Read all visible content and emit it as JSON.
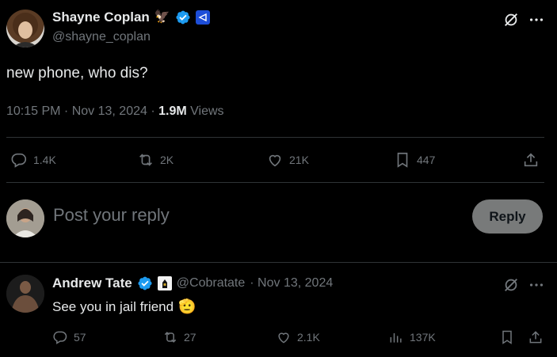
{
  "post": {
    "author_name": "Shayne Coplan",
    "author_handle": "@shayne_coplan",
    "text": "new phone, who dis?",
    "time": "10:15 PM · Nov 13, 2024 · ",
    "views_count": "1.9M",
    "views_label": " Views",
    "replies": "1.4K",
    "reposts": "2K",
    "likes": "21K",
    "bookmarks": "447"
  },
  "composer": {
    "placeholder": "Post your reply",
    "button_label": "Reply"
  },
  "reply": {
    "author_name": "Andrew Tate",
    "author_handle": "@Cobratate",
    "date": " · Nov 13, 2024",
    "text": "See you in jail friend",
    "replies": "57",
    "reposts": "27",
    "likes": "2.1K",
    "views": "137K"
  },
  "icons": {
    "verified_color": "#1d9bf0",
    "affiliate_badge_color": "#1d4ed8",
    "names": [
      "eagle-emoji-icon",
      "verified-badge-icon",
      "affiliate-badge-icon",
      "grok-icon",
      "more-icon",
      "reply-icon",
      "repost-icon",
      "like-icon",
      "bookmark-icon",
      "share-icon",
      "views-icon",
      "saluting-face-emoji-icon"
    ]
  }
}
